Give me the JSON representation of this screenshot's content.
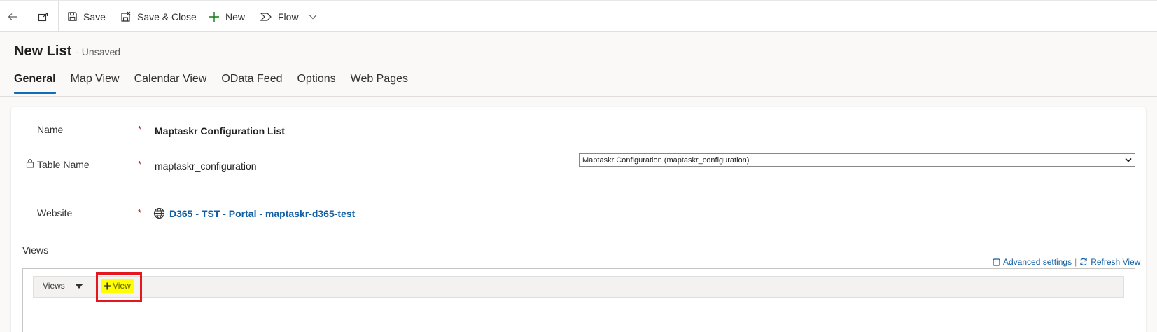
{
  "toolbar": {
    "save": "Save",
    "save_close": "Save & Close",
    "new": "New",
    "flow": "Flow"
  },
  "header": {
    "title": "New List",
    "status": "- Unsaved"
  },
  "tabs": [
    "General",
    "Map View",
    "Calendar View",
    "OData Feed",
    "Options",
    "Web Pages"
  ],
  "form": {
    "name_label": "Name",
    "name_value": "Maptaskr Configuration List",
    "table_label": "Table Name",
    "table_value": "maptaskr_configuration",
    "table_select": "Maptaskr Configuration (maptaskr_configuration)",
    "website_label": "Website",
    "website_value": "D365 - TST - Portal - maptaskr-d365-test",
    "required_mark": "*"
  },
  "views": {
    "section_label": "Views",
    "advanced_settings": "Advanced settings",
    "divider": "|",
    "refresh_view": "Refresh View",
    "dropdown_label": "Views",
    "add_view": "View"
  },
  "colors": {
    "accent": "#0f6cbd",
    "link": "#115ea3",
    "required": "#a4262c",
    "highlight": "#ffff00",
    "annotation": "#e4161e"
  }
}
